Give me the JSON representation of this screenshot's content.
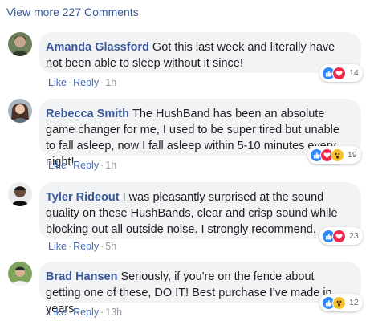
{
  "view_more": "View more 227 Comments",
  "comments": [
    {
      "author": "Amanda Glassford",
      "text": "Got this last week and literally have not been able to sleep without it since!",
      "like_label": "Like",
      "reply_label": "Reply",
      "time": "1h",
      "reaction_count": "14",
      "reactions": [
        "like-icon",
        "love-icon"
      ]
    },
    {
      "author": "Rebecca Smith",
      "text": "The HushBand has been an absolute game changer for me, I used to be super tired but unable to fall asleep, now I fall asleep within 5-10 minutes every night!",
      "like_label": "Like",
      "reply_label": "Reply",
      "time": "1h",
      "reaction_count": "19",
      "reactions": [
        "like-icon",
        "love-icon",
        "wow-icon"
      ]
    },
    {
      "author": "Tyler Rideout",
      "text": "I was pleasantly surprised at the sound quality on these HushBands, clear and crisp sound while blocking out all outside noise. I strongly recommend.",
      "like_label": "Like",
      "reply_label": "Reply",
      "time": "5h",
      "reaction_count": "23",
      "reactions": [
        "like-icon",
        "love-icon"
      ]
    },
    {
      "author": "Brad Hansen",
      "text": "Seriously, if you're on the fence about getting one of these, DO IT! Best purchase I've made in years",
      "like_label": "Like",
      "reply_label": "Reply",
      "time": "13h",
      "reaction_count": "12",
      "reactions": [
        "like-icon",
        "wow-icon"
      ]
    }
  ],
  "colors": {
    "link": "#385898",
    "action": "#4267b2",
    "bubble": "#f2f3f5",
    "like": "#2e89ff",
    "love": "#f0284a",
    "wow": "#f7c02a"
  }
}
